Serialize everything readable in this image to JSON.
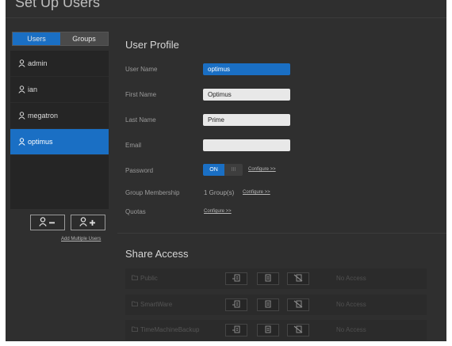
{
  "page": {
    "title": "Set Up Users"
  },
  "tabs": {
    "users": "Users",
    "groups": "Groups"
  },
  "users": [
    {
      "name": "admin"
    },
    {
      "name": "ian"
    },
    {
      "name": "megatron"
    },
    {
      "name": "optimus",
      "selected": true
    }
  ],
  "user_actions": {
    "remove_icon": "user-minus-icon",
    "add_icon": "user-plus-icon",
    "add_multiple": "Add Multiple Users"
  },
  "profile": {
    "title": "User Profile",
    "user_name_label": "User Name",
    "user_name_value": "optimus",
    "first_name_label": "First Name",
    "first_name_value": "Optimus",
    "last_name_label": "Last Name",
    "last_name_value": "Prime",
    "email_label": "Email",
    "email_value": "",
    "password_label": "Password",
    "password_on": "ON",
    "password_off": "III",
    "password_configure": "Configure >>",
    "group_label": "Group Membership",
    "group_value": "1 Group(s)",
    "group_configure": "Configure >>",
    "quotas_label": "Quotas",
    "quotas_configure": "Configure >>"
  },
  "share_access": {
    "title": "Share Access",
    "shares": [
      {
        "name": "Public",
        "access": "No Access"
      },
      {
        "name": "SmartWare",
        "access": "No Access"
      },
      {
        "name": "TimeMachineBackup",
        "access": "No Access"
      }
    ]
  },
  "colors": {
    "accent": "#1a6fc4",
    "background": "#2f2f2f",
    "panel": "#252525"
  }
}
